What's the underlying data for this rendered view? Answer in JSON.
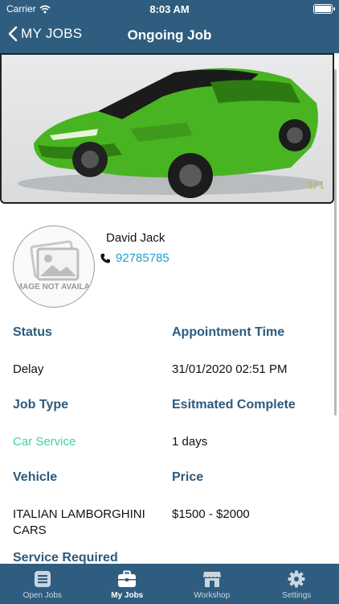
{
  "status_bar": {
    "carrier": "Carrier",
    "time": "8:03 AM"
  },
  "nav": {
    "back_label": "MY JOBS",
    "title": "Ongoing Job"
  },
  "gallery": {
    "counter": "1/1"
  },
  "customer": {
    "avatar_text": "IMAGE NOT AVAILABLE",
    "name": "David Jack",
    "phone": "92785785"
  },
  "details": {
    "status_label": "Status",
    "status_value": "Delay",
    "appointment_label": "Appointment Time",
    "appointment_value": "31/01/2020 02:51 PM",
    "job_type_label": "Job Type",
    "job_type_value": "Car Service",
    "estimated_label": "Esitmated Complete",
    "estimated_value": "1 days",
    "vehicle_label": "Vehicle",
    "vehicle_value_line1": "ITALIAN LAMBORGHINI",
    "vehicle_value_line2": "CARS",
    "price_label": "Price",
    "price_value": "$1500 - $2000",
    "service_label": "Service Required"
  },
  "tabs": [
    {
      "label": "Open Jobs",
      "icon": "list-icon"
    },
    {
      "label": "My Jobs",
      "icon": "briefcase-icon"
    },
    {
      "label": "Workshop",
      "icon": "shop-icon"
    },
    {
      "label": "Settings",
      "icon": "gear-icon"
    }
  ],
  "colors": {
    "bar": "#2f5d7f",
    "label": "#2c5a7c",
    "link": "#1e9fd6",
    "accent_green": "#3ed3a4"
  }
}
